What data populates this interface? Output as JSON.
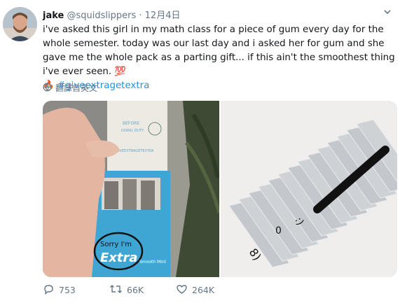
{
  "user": {
    "name": "jake",
    "handle": "@squidslippers",
    "separator": "·",
    "time": "12月4日"
  },
  "tweet": {
    "text": "i've asked this girl in my math class for a piece of gum every day for the whole semester. today was our last day and i asked her for gum and she gave me the whole pack as a parting gift... if this ain't the smoothest thing i've ever seen. 💯",
    "fire_emoji": "🔥",
    "hashtag": "#giveextragetextra"
  },
  "translate": {
    "label": "翻譯自英文",
    "icon": "globe-icon"
  },
  "media": {
    "left_photo": {
      "written_text": "Sorry I'm",
      "brand_text": "Extra",
      "flavor_text": "Smooth Mint",
      "back_hashtag": "#GIVEEXTRAGETEXTRA"
    },
    "right_photo": {
      "marks": [
        "8)",
        "0",
        ":)"
      ]
    }
  },
  "actions": {
    "replies": "753",
    "retweets": "66K",
    "likes": "264K"
  },
  "colors": {
    "link": "#1b95e0",
    "secondary": "#657786",
    "primary_text": "#14171a",
    "extra_blue": "#3fa6d3"
  }
}
